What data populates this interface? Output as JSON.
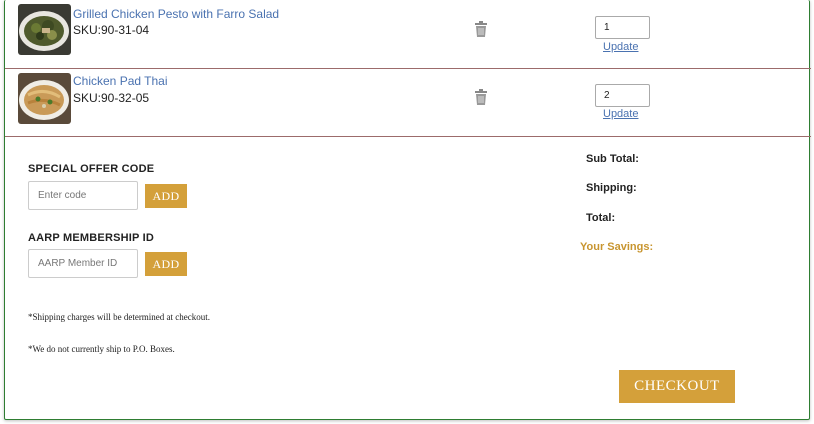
{
  "cart_items": [
    {
      "name": "Grilled Chicken Pesto with Farro Salad",
      "sku": "SKU:90-31-04",
      "quantity": "1",
      "update_label": "Update",
      "thumbnail_icon": "grilled-chicken-pesto-photo",
      "delete_icon": "trash-icon"
    },
    {
      "name": "Chicken Pad Thai",
      "sku": "SKU:90-32-05",
      "quantity": "2",
      "update_label": "Update",
      "thumbnail_icon": "chicken-pad-thai-photo",
      "delete_icon": "trash-icon"
    }
  ],
  "promo": {
    "offer_label": "SPECIAL OFFER CODE",
    "offer_placeholder": "Enter code",
    "offer_button": "ADD",
    "aarp_label": "AARP MEMBERSHIP ID",
    "aarp_placeholder": "AARP Member ID",
    "aarp_button": "ADD"
  },
  "notes": [
    "*Shipping charges will be determined at checkout.",
    "*We do not currently ship to P.O. Boxes."
  ],
  "summary": {
    "subtotal_label": "Sub Total:",
    "shipping_label": "Shipping:",
    "total_label": "Total:",
    "savings_label": "Your Savings:"
  },
  "checkout_label": "CHECKOUT",
  "colors": {
    "accent": "#d4a03a",
    "savings_text": "#c8952f",
    "link": "#4a72b0",
    "frame_border": "#2e7d32",
    "row_divider": "#9c6b6b"
  }
}
